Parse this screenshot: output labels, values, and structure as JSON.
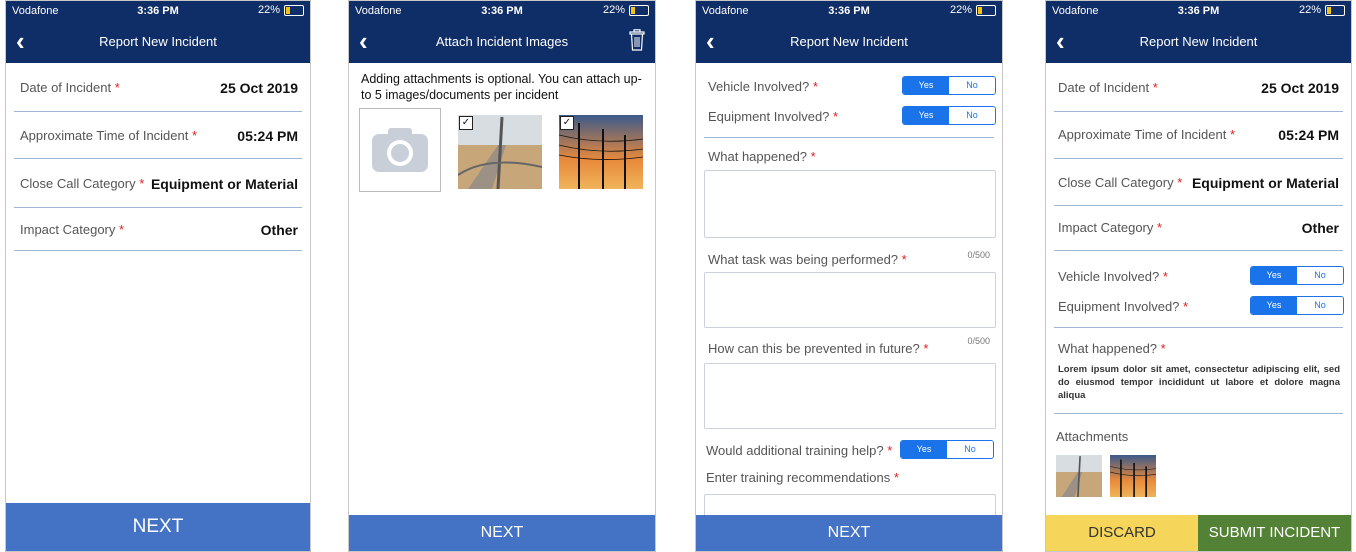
{
  "status": {
    "carrier": "Vodafone",
    "time": "3:36 PM",
    "battery": "22%"
  },
  "colors": {
    "nav": "#0f2d66",
    "accent": "#4472c4",
    "toggle": "#1a73e8",
    "required": "#e02020",
    "discard": "#f5d55a",
    "submit": "#538135"
  },
  "screen1": {
    "title": "Report New Incident",
    "fields": [
      {
        "label": "Date of Incident",
        "value": "25 Oct 2019"
      },
      {
        "label": "Approximate Time of Incident",
        "value": "05:24 PM"
      },
      {
        "label": "Close Call Category",
        "value": "Equipment or Material"
      },
      {
        "label": "Impact Category",
        "value": "Other"
      }
    ],
    "next": "NEXT"
  },
  "screen2": {
    "title": "Attach Incident Images",
    "info": "Adding attachments is optional. You can attach up-to 5 images/documents per incident",
    "next": "NEXT"
  },
  "screen3": {
    "title": "Report New Incident",
    "vehicle": "Vehicle Involved?",
    "equipment": "Equipment Involved?",
    "yes": "Yes",
    "no": "No",
    "what_happened": "What happened?",
    "task": "What task was being performed?",
    "prevent": "How can this be prevented in future?",
    "counter": "0/500",
    "training": "Would additional training help?",
    "recommend": "Enter training recommendations",
    "next": "NEXT"
  },
  "screen4": {
    "title": "Report New Incident",
    "fields": [
      {
        "label": "Date of Incident",
        "value": "25 Oct 2019"
      },
      {
        "label": "Approximate Time of Incident",
        "value": "05:24 PM"
      },
      {
        "label": "Close Call Category",
        "value": "Equipment or Material"
      },
      {
        "label": "Impact Category",
        "value": "Other"
      }
    ],
    "vehicle": "Vehicle Involved?",
    "equipment": "Equipment Involved?",
    "yes": "Yes",
    "no": "No",
    "what_happened": "What happened?",
    "description": "Lorem ipsum dolor sit amet, consectetur adipiscing elit, sed do eiusmod tempor incididunt ut labore et dolore magna aliqua",
    "attachments": "Attachments",
    "discard": "DISCARD",
    "submit": "SUBMIT INCIDENT"
  }
}
